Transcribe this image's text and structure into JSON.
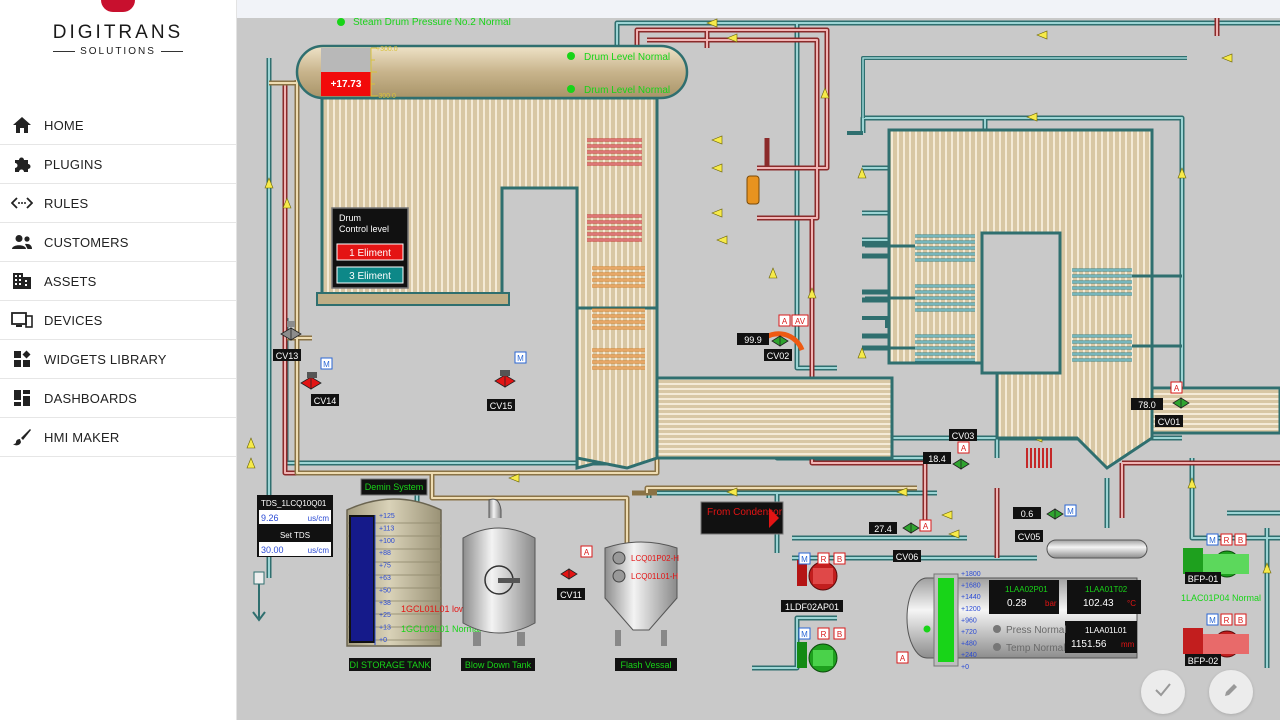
{
  "brand": {
    "name": "DIGITRANS",
    "tagline": "SOLUTIONS"
  },
  "nav": {
    "items": [
      {
        "label": "HOME",
        "icon": "home-icon"
      },
      {
        "label": "PLUGINS",
        "icon": "puzzle-icon"
      },
      {
        "label": "RULES",
        "icon": "code-arrows-icon"
      },
      {
        "label": "CUSTOMERS",
        "icon": "people-icon"
      },
      {
        "label": "ASSETS",
        "icon": "building-icon"
      },
      {
        "label": "DEVICES",
        "icon": "devices-icon"
      },
      {
        "label": "WIDGETS LIBRARY",
        "icon": "widgets-icon"
      },
      {
        "label": "DASHBOARDS",
        "icon": "dashboard-icon"
      },
      {
        "label": "HMI MAKER",
        "icon": "brush-icon"
      }
    ]
  },
  "hmi": {
    "top_status": "Steam Drum Pressure No.2 Normal",
    "drum": {
      "value": "+17.73",
      "scale_top": "+300.0",
      "scale_bottom": "-300.0",
      "status1": "Drum Level Normal",
      "status2": "Drum Level Normal"
    },
    "drum_control": {
      "title": "Drum Control level",
      "btn1": "1 Eliment",
      "btn2": "3 Eliment"
    },
    "valves": {
      "cv13": "CV13",
      "cv14": "CV14",
      "cv15": "CV15",
      "cv02": "CV02",
      "cv01": "CV01",
      "cv03": "CV03",
      "cv05": "CV05",
      "cv06": "CV06",
      "cv11": "CV11",
      "cv02_value": "99.9",
      "cv01_value": "78.0",
      "cv03_value": "18.4",
      "cv05_value": "0.6",
      "cv06_value": "27.4",
      "mode_m": "M",
      "mode_a": "A",
      "mode_av": "AV",
      "mode_r": "R",
      "mode_b": "B"
    },
    "tds": {
      "tag": "TDS_1LCQ10Q01",
      "value": "9.26",
      "unit": "us/cm",
      "set_label": "Set TDS",
      "set_value": "30.00"
    },
    "demin_label": "Demin System",
    "di_tank": {
      "label": "DI STORAGE TANK",
      "scale": [
        "+125",
        "+113",
        "+100",
        "+88",
        "+75",
        "+63",
        "+50",
        "+38",
        "+25",
        "+13",
        "+0"
      ],
      "status1": "1GCL01L01 low",
      "status2": "1GCL02L01 Normal"
    },
    "blowdown_label": "Blow Down Tank",
    "flash": {
      "label": "Flash Vessal",
      "tag1": "LCQ01P02-H",
      "tag2": "LCQ01L01-H"
    },
    "condensor": "From Condensor",
    "pump_ldf": "1LDF02AP01",
    "deaerator": {
      "scale": [
        "+1800",
        "+1680",
        "+1440",
        "+1200",
        "+960",
        "+720",
        "+480",
        "+240",
        "+0"
      ],
      "p_tag": "1LAA02P01",
      "p_value": "0.28",
      "p_unit": "bar",
      "t_tag": "1LAA01T02",
      "t_value": "102.43",
      "t_unit": "°C",
      "l_tag": "1LAA01L01",
      "l_value": "1151.56",
      "l_unit": "mm",
      "press_status": "Press Normal",
      "temp_status": "Temp Normal"
    },
    "bfp": {
      "p1": "BFP-01",
      "p2": "BFP-02",
      "status": "1LAC01P04 Normal"
    }
  }
}
